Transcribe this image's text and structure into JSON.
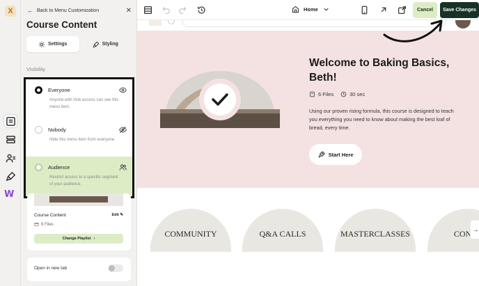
{
  "panel": {
    "back_label": "Back to Menu Customization",
    "title": "Course Content",
    "tabs": [
      {
        "label": "Settings"
      },
      {
        "label": "Styling"
      }
    ],
    "section_label": "Visibility",
    "options": [
      {
        "label": "Everyone",
        "desc": "Anyone with Hub access can see this menu item."
      },
      {
        "label": "Nobody",
        "desc": "Hide this menu item from everyone."
      },
      {
        "label": "Audience",
        "desc": "Restrict access to a specific segment of your audience."
      }
    ],
    "card": {
      "title": "Course Content",
      "edit_label": "Edit",
      "files": "6 Files",
      "playlist_button": "Change Playlist"
    },
    "new_tab_label": "Open in new tab"
  },
  "toolbar": {
    "page_name": "Home",
    "cancel_label": "Cancel",
    "save_label": "Save Changes"
  },
  "hero": {
    "title": "Welcome to Baking Basics, Beth!",
    "files": "6 Files",
    "duration": "30 sec",
    "description": "Using our proven rising formula, this course is designed to teach you everything you need to know about making the best loaf of bread, every time.",
    "start_label": "Start Here"
  },
  "sections": [
    "COMMUNITY",
    "Q&A CALLS",
    "MASTERCLASSES",
    "CONTA"
  ]
}
